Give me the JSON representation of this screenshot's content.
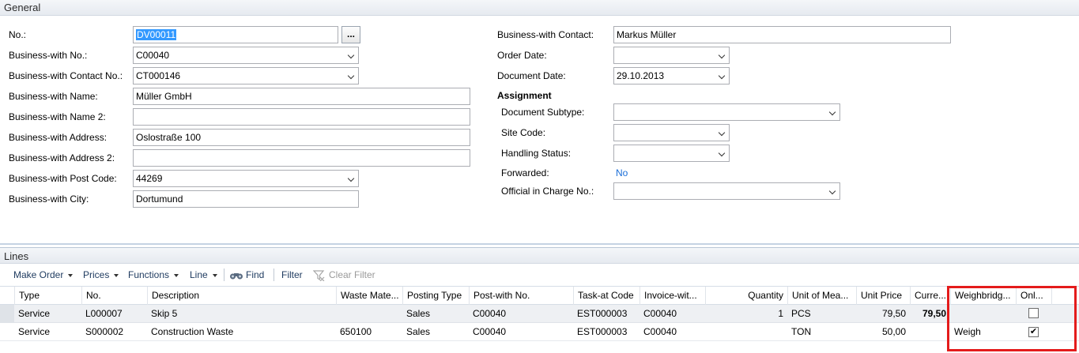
{
  "general": {
    "title": "General",
    "left_fields": [
      {
        "label": "No.:",
        "value": "DV00011"
      },
      {
        "label": "Business-with No.:",
        "value": "C00040"
      },
      {
        "label": "Business-with Contact No.:",
        "value": "CT000146"
      },
      {
        "label": "Business-with Name:",
        "value": "Müller GmbH"
      },
      {
        "label": "Business-with Name 2:",
        "value": ""
      },
      {
        "label": "Business-with Address:",
        "value": "Oslostraße 100"
      },
      {
        "label": "Business-with Address 2:",
        "value": ""
      },
      {
        "label": "Business-with Post Code:",
        "value": "44269"
      },
      {
        "label": "Business-with City:",
        "value": "Dortumund"
      }
    ],
    "assist_button": "...",
    "right_fields": [
      {
        "label": "Business-with Contact:",
        "value": "Markus Müller"
      },
      {
        "label": "Order Date:",
        "value": ""
      },
      {
        "label": "Document Date:",
        "value": "29.10.2013"
      }
    ],
    "assignment_heading": "Assignment",
    "assignment_fields": [
      {
        "label": "Document Subtype:",
        "value": ""
      },
      {
        "label": "Site Code:",
        "value": ""
      },
      {
        "label": "Handling Status:",
        "value": ""
      },
      {
        "label": "Forwarded:",
        "value": "No"
      },
      {
        "label": "Official in Charge No.:",
        "value": ""
      }
    ]
  },
  "lines": {
    "title": "Lines",
    "toolbar": {
      "make_order": "Make Order",
      "prices": "Prices",
      "functions": "Functions",
      "line": "Line",
      "find": "Find",
      "filter": "Filter",
      "clear_filter": "Clear Filter"
    },
    "columns": [
      "Type",
      "No.",
      "Description",
      "Waste Mate...",
      "Posting Type",
      "Post-with No.",
      "Task-at Code",
      "Invoice-wit...",
      "Quantity",
      "Unit of Mea...",
      "Unit Price",
      "Curre...",
      "Weighbridg...",
      "Onl..."
    ],
    "rows": [
      {
        "type": "Service",
        "no": "L000007",
        "description": "Skip 5",
        "waste": "",
        "posting_type": "Sales",
        "post_with": "C00040",
        "task_at": "EST000003",
        "invoice_with": "C00040",
        "quantity": "1",
        "uom": "PCS",
        "unit_price": "79,50",
        "curr": "79,50",
        "weighbridge": "",
        "online": false
      },
      {
        "type": "Service",
        "no": "S000002",
        "description": "Construction Waste",
        "waste": "650100",
        "posting_type": "Sales",
        "post_with": "C00040",
        "task_at": "EST000003",
        "invoice_with": "C00040",
        "quantity": "",
        "uom": "TON",
        "unit_price": "50,00",
        "curr": "",
        "weighbridge": "Weigh",
        "online": true
      }
    ],
    "check_mark": "✔"
  },
  "colors": {
    "accent": "#1a6ed8",
    "selection": "#3399ff",
    "highlight_box": "#e41b1b"
  }
}
